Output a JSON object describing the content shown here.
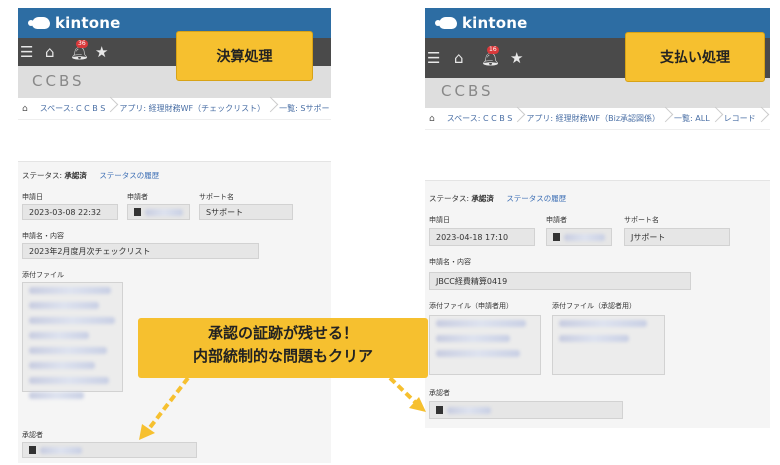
{
  "app": {
    "logo_text": "kintone",
    "app_name": "CCBS"
  },
  "left": {
    "notification_count": "36",
    "tag_label": "決算処理",
    "breadcrumb": [
      "スペース: C C B S",
      "アプリ: 経理財務WF（チェックリスト）",
      "一覧: Sサポート"
    ],
    "status_label": "ステータス:",
    "status_value": "承認済",
    "status_history": "ステータスの履歴",
    "fields": {
      "date_label": "申請日",
      "date_value": "2023-03-08 22:32",
      "applicant_label": "申請者",
      "support_label": "サポート名",
      "support_value": "Sサポート",
      "content_label": "申請名・内容",
      "content_value": "2023年2月度月次チェックリスト",
      "attachment_label": "添付ファイル",
      "approver_label": "承認者"
    }
  },
  "right": {
    "notification_count": "16",
    "tag_label": "支払い処理",
    "breadcrumb": [
      "スペース: C C B S",
      "アプリ: 経理財務WF（Biz承認図係）",
      "一覧: ALL",
      "レコード"
    ],
    "status_label": "ステータス:",
    "status_value": "承認済",
    "status_history": "ステータスの履歴",
    "fields": {
      "date_label": "申請日",
      "date_value": "2023-04-18 17:10",
      "applicant_label": "申請者",
      "support_label": "サポート名",
      "support_value": "Jサポート",
      "content_label": "申請名・内容",
      "content_value": "JBCC経費精算0419",
      "attachment_applicant_label": "添付ファイル（申請者用）",
      "attachment_approver_label": "添付ファイル（承認者用）",
      "approver_label": "承認者"
    }
  },
  "callout": {
    "line1": "承認の証跡が残せる！",
    "line2": "内部統制的な問題もクリア"
  },
  "colors": {
    "brand": "#2d6da3",
    "accent": "#f6c02f",
    "nav": "#4a4a4a",
    "link": "#3d6fb5"
  },
  "icons": [
    "menu-icon",
    "home-icon",
    "bell-icon",
    "star-icon",
    "user-icon"
  ]
}
